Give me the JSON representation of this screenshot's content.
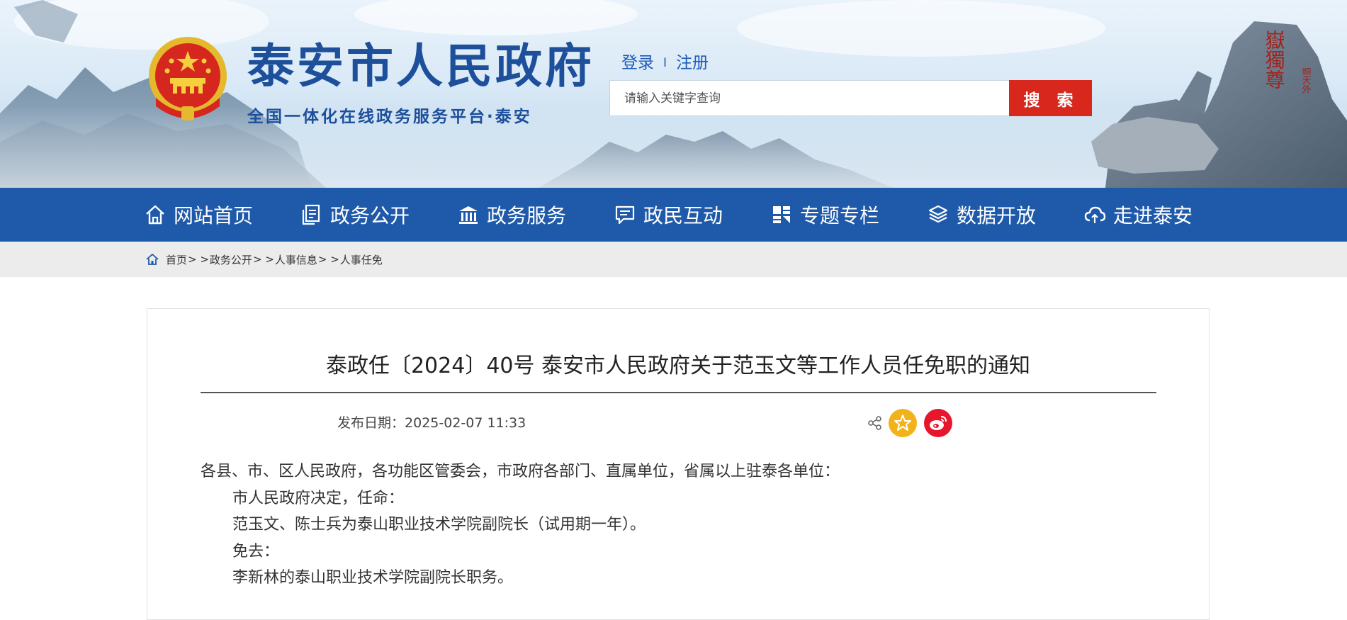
{
  "header": {
    "site_title": "泰安市人民政府",
    "site_subtitle": "全国一体化在线政务服务平台·泰安",
    "login_label": "登录",
    "separator": "I",
    "register_label": "注册",
    "search_placeholder": "请输入关键字查询",
    "search_button_label": "搜 索",
    "calligraphy_text": "五嶽獨尊",
    "calligraphy_small_text": "昂頭天外",
    "accent_color": "#1f5aaa",
    "search_color": "#d8271c"
  },
  "nav": {
    "items": [
      {
        "label": "网站首页",
        "icon": "home-icon"
      },
      {
        "label": "政务公开",
        "icon": "document-icon"
      },
      {
        "label": "政务服务",
        "icon": "building-icon"
      },
      {
        "label": "政民互动",
        "icon": "chat-icon"
      },
      {
        "label": "专题专栏",
        "icon": "grid-icon"
      },
      {
        "label": "数据开放",
        "icon": "layers-icon"
      },
      {
        "label": "走进泰安",
        "icon": "cloud-icon"
      }
    ]
  },
  "breadcrumb": {
    "items": [
      "首页",
      "政务公开",
      "人事信息",
      "人事任免"
    ],
    "separator": "> >"
  },
  "article": {
    "title": "泰政任〔2024〕40号 泰安市人民政府关于范玉文等工作人员任免职的通知",
    "publish_label": "发布日期：",
    "publish_date": "2025-02-07 11:33",
    "paragraphs": [
      "各县、市、区人民政府，各功能区管委会，市政府各部门、直属单位，省属以上驻泰各单位：",
      "市人民政府决定，任命：",
      "范玉文、陈士兵为泰山职业技术学院副院长（试用期一年）。",
      "免去：",
      "李新林的泰山职业技术学院副院长职务。"
    ]
  }
}
